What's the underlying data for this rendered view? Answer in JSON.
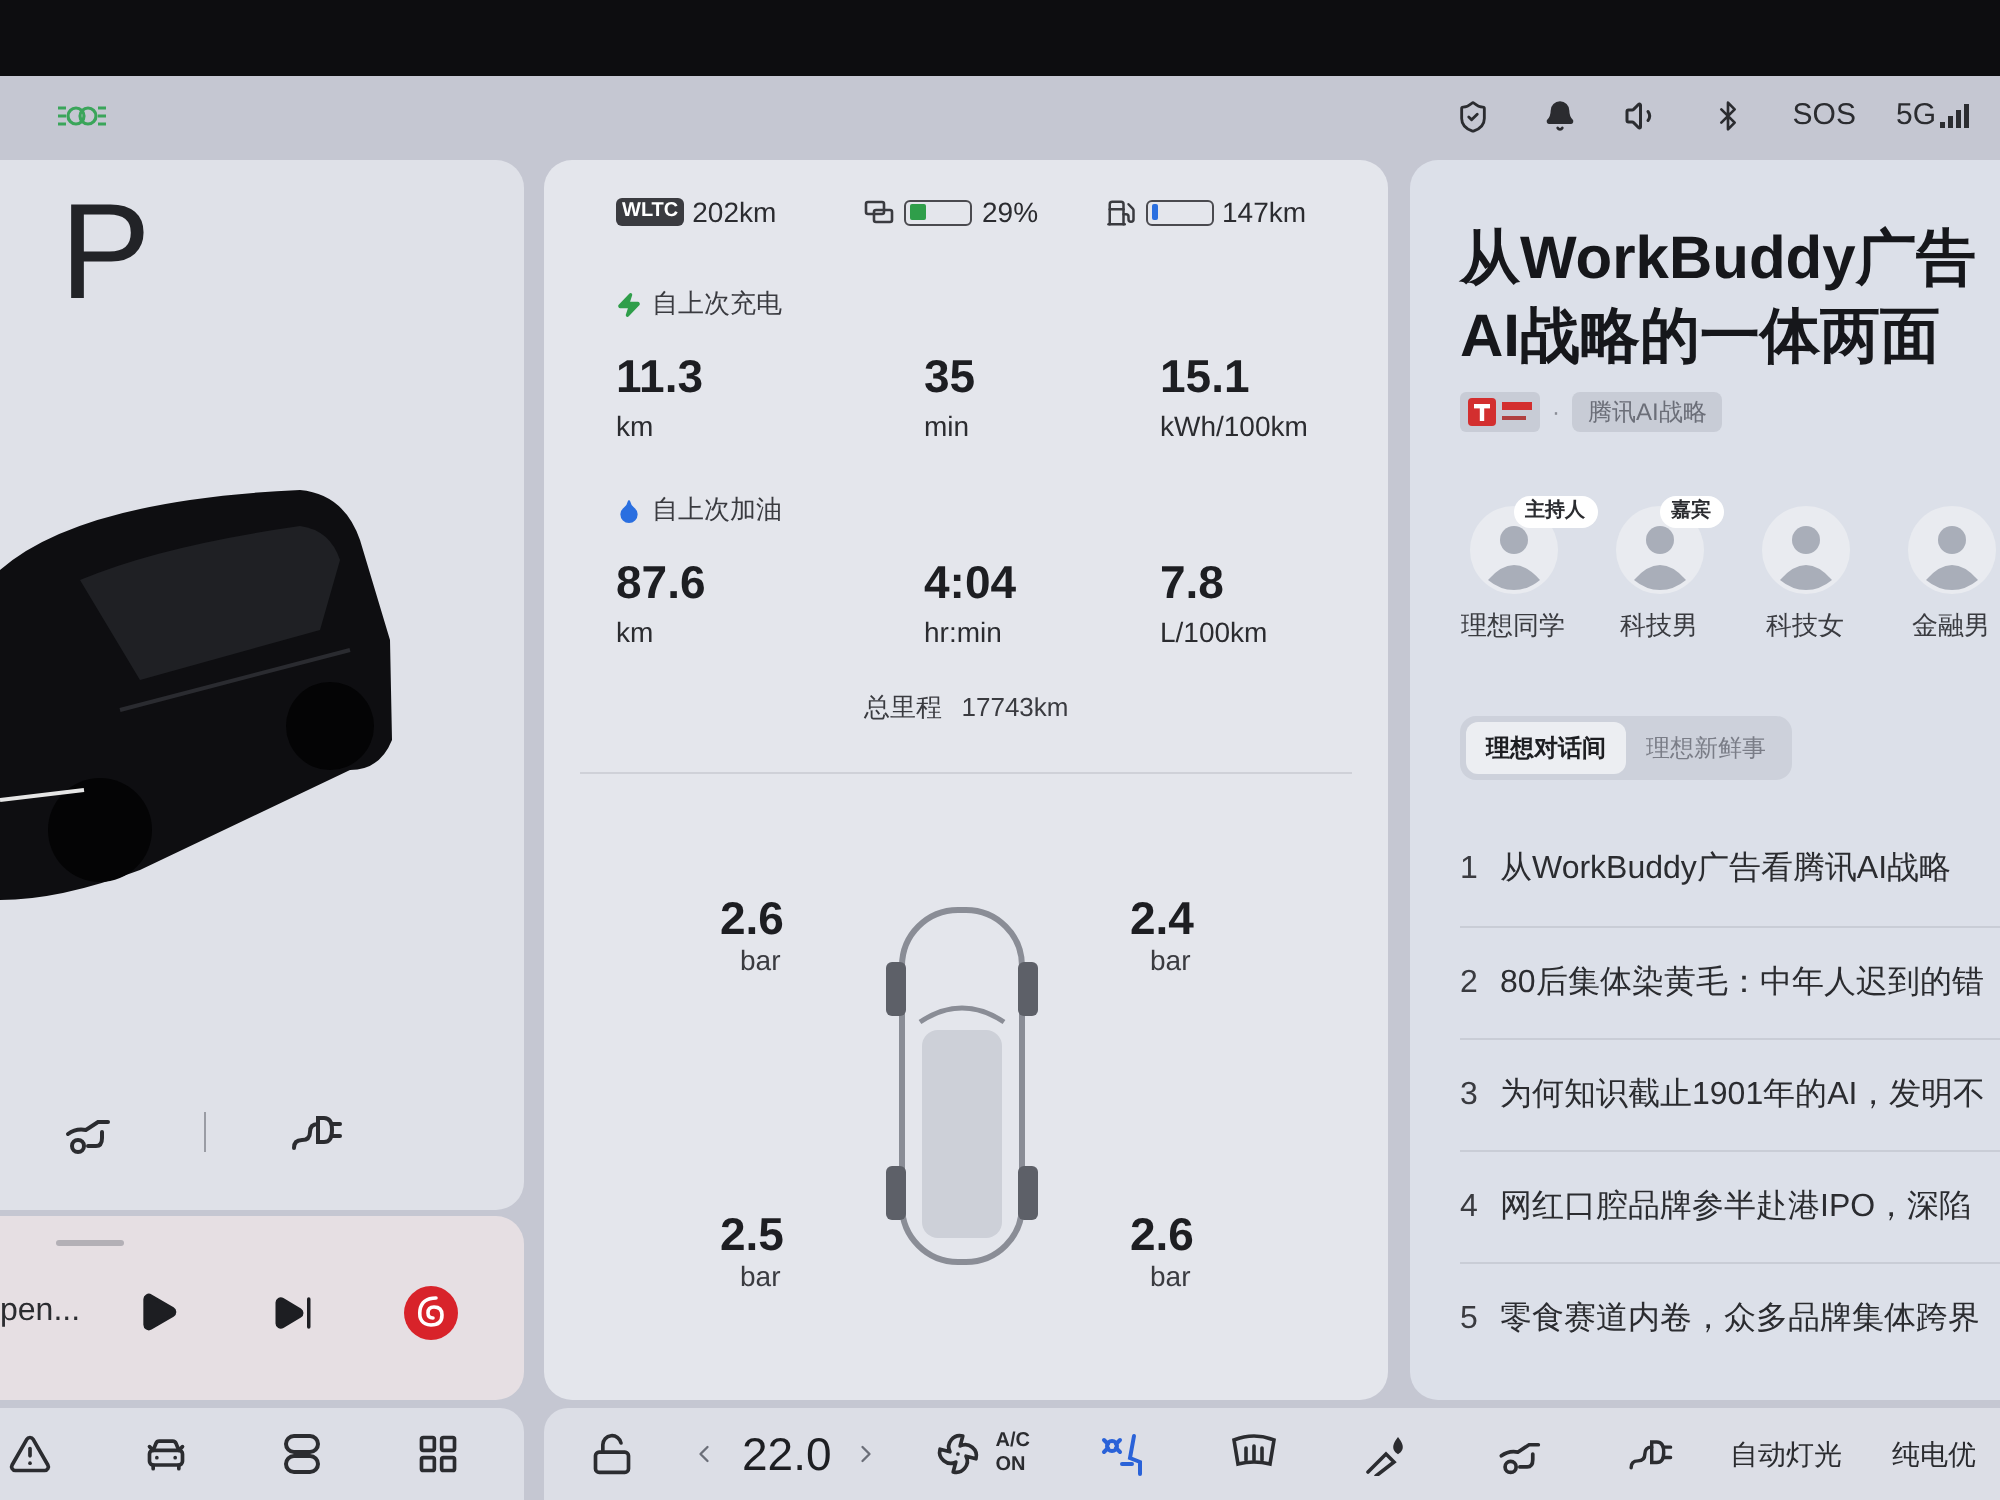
{
  "status_bar": {
    "sos": "SOS",
    "network": "5G"
  },
  "vehicle": {
    "gear": "P",
    "media": {
      "title": "pen...",
      "playing": false
    }
  },
  "energy": {
    "badge": "WLTC",
    "range": "202km",
    "battery": {
      "level": 0.29,
      "reading": "29%"
    },
    "fuel": {
      "level": 0.12,
      "reading": "147km"
    }
  },
  "trips": [
    {
      "kind": "charge",
      "title": "自上次充电",
      "stats": [
        {
          "value": "11.3",
          "unit": "km"
        },
        {
          "value": "35",
          "unit": "min"
        },
        {
          "value": "15.1",
          "unit": "kWh/100km"
        }
      ]
    },
    {
      "kind": "refuel",
      "title": "自上次加油",
      "stats": [
        {
          "value": "87.6",
          "unit": "km"
        },
        {
          "value": "4:04",
          "unit": "hr:min"
        },
        {
          "value": "7.8",
          "unit": "L/100km"
        }
      ]
    }
  ],
  "odometer": {
    "label": "总里程",
    "value": "17743km"
  },
  "tires": [
    {
      "value": "2.6",
      "unit": "bar"
    },
    {
      "value": "2.4",
      "unit": "bar"
    },
    {
      "value": "2.5",
      "unit": "bar"
    },
    {
      "value": "2.6",
      "unit": "bar"
    }
  ],
  "article": {
    "title_lines": [
      "从WorkBuddy广告",
      "AI战略的一体两面"
    ],
    "separator": "·",
    "tag": "腾讯AI战略",
    "hosts": [
      {
        "name": "理想同学",
        "role": "主持人"
      },
      {
        "name": "科技男",
        "role": "嘉宾"
      },
      {
        "name": "科技女"
      },
      {
        "name": "金融男"
      }
    ],
    "tabs": [
      {
        "label": "理想对话间",
        "selected": true
      },
      {
        "label": "理想新鲜事",
        "selected": false
      }
    ],
    "items": [
      {
        "index": "1",
        "text": "从WorkBuddy广告看腾讯AI战略"
      },
      {
        "index": "2",
        "text": "80后集体染黄毛：中年人迟到的错"
      },
      {
        "index": "3",
        "text": "为何知识截止1901年的AI，发明不"
      },
      {
        "index": "4",
        "text": "网红口腔品牌参半赴港IPO，深陷"
      },
      {
        "index": "5",
        "text": "零食赛道内卷，众多品牌集体跨界"
      }
    ]
  },
  "dock": {
    "temperature": "22.0",
    "ac": {
      "label": "A/C",
      "state": "ON"
    },
    "seat_ventilation": {
      "on": true
    },
    "buttons": [
      "自动灯光",
      "纯电优"
    ]
  }
}
